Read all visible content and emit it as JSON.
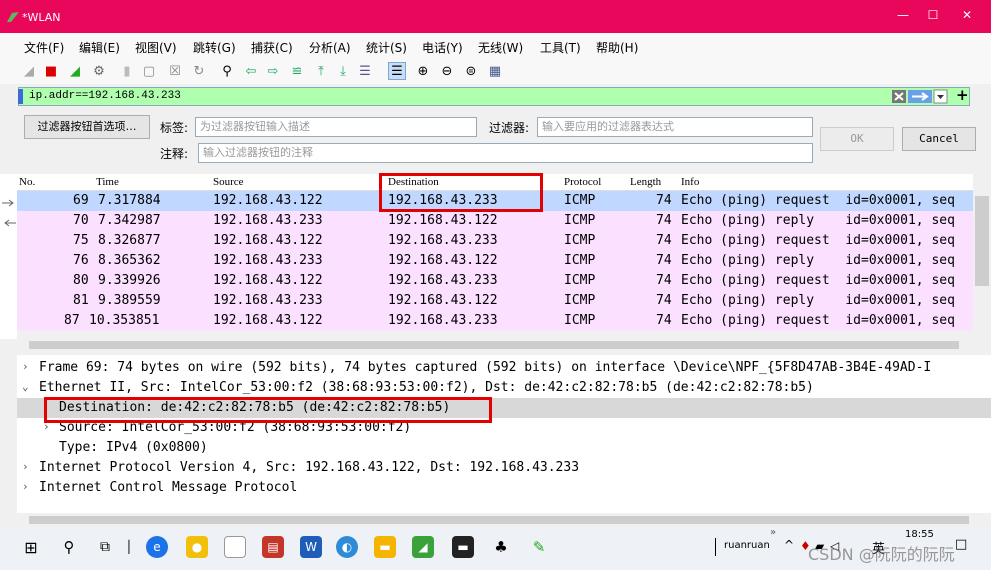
{
  "window": {
    "title": "*WLAN"
  },
  "menu": [
    "文件(F)",
    "编辑(E)",
    "视图(V)",
    "跳转(G)",
    "捕获(C)",
    "分析(A)",
    "统计(S)",
    "电话(Y)",
    "无线(W)",
    "工具(T)",
    "帮助(H)"
  ],
  "display_filter": {
    "value": "ip.addr==192.168.43.233"
  },
  "filter_buttons": {
    "prefs_label": "过滤器按钮首选项…",
    "tag_label": "标签:",
    "tag_placeholder": "为过滤器按钮输入描述",
    "filter_label": "过滤器:",
    "filter_placeholder": "输入要应用的过滤器表达式",
    "comment_label": "注释:",
    "comment_placeholder": "输入过滤器按钮的注释",
    "ok_label": "OK",
    "cancel_label": "Cancel"
  },
  "packet_list": {
    "columns": [
      "No.",
      "Time",
      "Source",
      "Destination",
      "Protocol",
      "Length",
      "Info"
    ],
    "rows": [
      {
        "no": "69",
        "time": "7.317884",
        "src": "192.168.43.122",
        "dst": "192.168.43.233",
        "proto": "ICMP",
        "len": "74",
        "info": "Echo (ping) request  id=0x0001, seq"
      },
      {
        "no": "70",
        "time": "7.342987",
        "src": "192.168.43.233",
        "dst": "192.168.43.122",
        "proto": "ICMP",
        "len": "74",
        "info": "Echo (ping) reply    id=0x0001, seq"
      },
      {
        "no": "75",
        "time": "8.326877",
        "src": "192.168.43.122",
        "dst": "192.168.43.233",
        "proto": "ICMP",
        "len": "74",
        "info": "Echo (ping) request  id=0x0001, seq"
      },
      {
        "no": "76",
        "time": "8.365362",
        "src": "192.168.43.233",
        "dst": "192.168.43.122",
        "proto": "ICMP",
        "len": "74",
        "info": "Echo (ping) reply    id=0x0001, seq"
      },
      {
        "no": "80",
        "time": "9.339926",
        "src": "192.168.43.122",
        "dst": "192.168.43.233",
        "proto": "ICMP",
        "len": "74",
        "info": "Echo (ping) request  id=0x0001, seq"
      },
      {
        "no": "81",
        "time": "9.389559",
        "src": "192.168.43.233",
        "dst": "192.168.43.122",
        "proto": "ICMP",
        "len": "74",
        "info": "Echo (ping) reply    id=0x0001, seq"
      },
      {
        "no": "87",
        "time": "10.353851",
        "src": "192.168.43.122",
        "dst": "192.168.43.233",
        "proto": "ICMP",
        "len": "74",
        "info": "Echo (ping) request  id=0x0001, seq"
      }
    ]
  },
  "details": [
    {
      "arrow": "›",
      "text": "Frame 69: 74 bytes on wire (592 bits), 74 bytes captured (592 bits) on interface \\Device\\NPF_{5F8D47AB-3B4E-49AD-I"
    },
    {
      "arrow": "⌄",
      "text": "Ethernet II, Src: IntelCor_53:00:f2 (38:68:93:53:00:f2), Dst: de:42:c2:82:78:b5 (de:42:c2:82:78:b5)"
    },
    {
      "arrow": "",
      "text": "Destination: de:42:c2:82:78:b5 (de:42:c2:82:78:b5)"
    },
    {
      "arrow": "›",
      "text": "Source: IntelCor_53:00:f2 (38:68:93:53:00:f2)"
    },
    {
      "arrow": "",
      "text": "Type: IPv4 (0x0800)"
    },
    {
      "arrow": "›",
      "text": "Internet Protocol Version 4, Src: 192.168.43.122, Dst: 192.168.43.233"
    },
    {
      "arrow": "›",
      "text": "Internet Control Message Protocol"
    }
  ],
  "taskbar": {
    "user": "ruanruan",
    "time": "18:55",
    "ime": "英",
    "watermark": "CSDN @阮阮的阮阮"
  },
  "colors": {
    "titlebar": "#e8075a",
    "filter_bg": "#afffaf",
    "row_bg": "#fce0ff",
    "row_selected": "#c0d8ff",
    "highlight": "#e30000"
  }
}
